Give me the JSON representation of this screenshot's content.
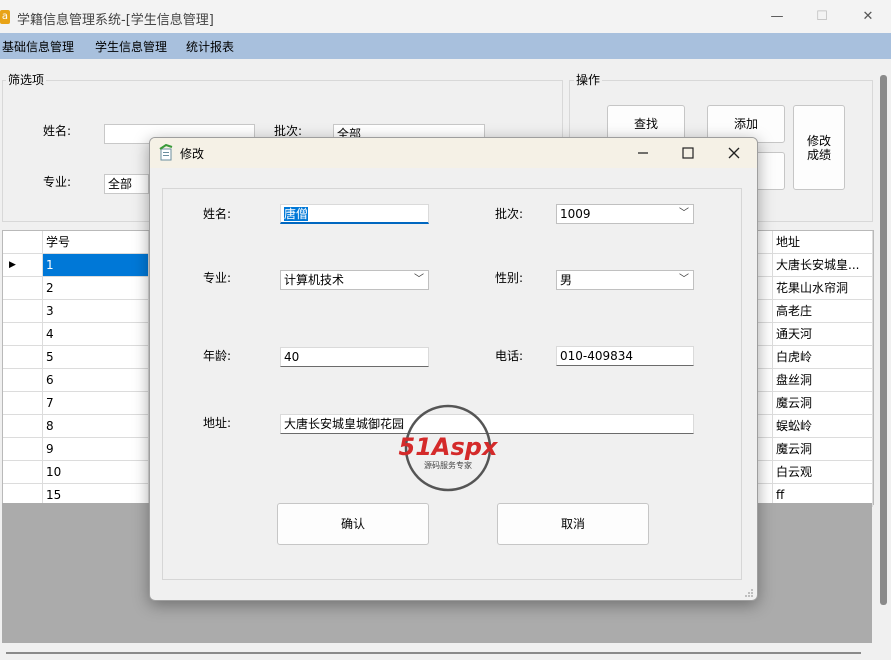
{
  "window": {
    "title": "学籍信息管理系统-[学生信息管理]",
    "controls": {
      "minimize": "—",
      "maximize": "☐",
      "close": "✕"
    }
  },
  "menu": [
    "基础信息管理",
    "学生信息管理",
    "统计报表"
  ],
  "filter": {
    "title": "筛选项",
    "name_label": "姓名:",
    "name_value": "",
    "batch_label": "批次:",
    "batch_value": "全部",
    "major_label": "专业:",
    "major_value": "全部"
  },
  "ops": {
    "title": "操作",
    "find": "查找",
    "add": "添加",
    "edit_score": "修改成绩"
  },
  "grid": {
    "headers": {
      "id": "学号",
      "address": "地址"
    },
    "rows": [
      {
        "id": "1",
        "address": "大唐长安城皇..."
      },
      {
        "id": "2",
        "address": "花果山水帘洞"
      },
      {
        "id": "3",
        "address": "高老庄"
      },
      {
        "id": "4",
        "address": "通天河"
      },
      {
        "id": "5",
        "address": "白虎岭"
      },
      {
        "id": "6",
        "address": "盘丝洞"
      },
      {
        "id": "7",
        "address": "魔云洞"
      },
      {
        "id": "8",
        "address": "蜈蚣岭"
      },
      {
        "id": "9",
        "address": "魔云洞"
      },
      {
        "id": "10",
        "address": "白云观"
      },
      {
        "id": "15",
        "address": "ff"
      }
    ],
    "current_row_marker": "▶"
  },
  "dialog": {
    "title": "修改",
    "name_label": "姓名:",
    "name_value": "唐僧",
    "batch_label": "批次:",
    "batch_value": "1009",
    "major_label": "专业:",
    "major_value": "计算机技术",
    "gender_label": "性别:",
    "gender_value": "男",
    "age_label": "年龄:",
    "age_value": "40",
    "phone_label": "电话:",
    "phone_value": "010-409834",
    "address_label": "地址:",
    "address_value": "大唐长安城皇城御花园",
    "confirm": "确认",
    "cancel": "取消"
  },
  "watermark": {
    "brand": "51Aspx",
    "tagline": "源码服务专家"
  }
}
